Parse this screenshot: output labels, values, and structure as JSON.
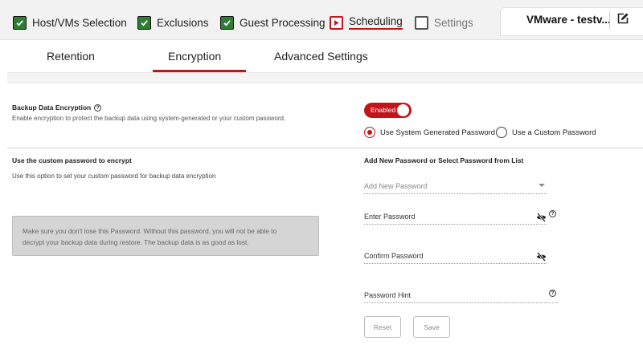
{
  "wizard": {
    "steps": [
      {
        "label": "Host/VMs Selection",
        "state": "complete"
      },
      {
        "label": "Exclusions",
        "state": "complete"
      },
      {
        "label": "Guest Processing",
        "state": "complete"
      },
      {
        "label": "Scheduling",
        "state": "current"
      },
      {
        "label": "Settings",
        "state": "pending"
      }
    ],
    "title": "VMware - testv...",
    "edit_icon": "edit-icon"
  },
  "tabs": {
    "retention": "Retention",
    "encryption": "Encryption",
    "advanced": "Advanced Settings",
    "active": "Encryption"
  },
  "encryption": {
    "title": "Backup Data Encryption",
    "help_icon": "help-icon",
    "description": "Enable encryption to protect the backup data using system-generated or your custom password.",
    "toggle_label": "Enabled",
    "toggle_on": true,
    "options": {
      "system": "Use System Generated Password",
      "custom": "Use a Custom Password",
      "selected": "system"
    }
  },
  "custom_password": {
    "title": "Use the custom password to encrypt",
    "description": "Use this option to set your custom password for backup data encryption",
    "warning_line1": "Make sure you don't lose this Password. Without this password, you will not be able to",
    "warning_line2": "decrypt your backup data during restore. The backup data is as good as lost."
  },
  "password_form": {
    "title": "Add New Password or Select Password from List",
    "select_placeholder": "Add New Password",
    "enter_password": "Enter Password",
    "confirm_password": "Confirm Password",
    "password_hint": "Password Hint",
    "reset_label": "Reset",
    "save_label": "Save"
  },
  "colors": {
    "accent": "#c0161b",
    "check_green": "#2e7d32"
  }
}
